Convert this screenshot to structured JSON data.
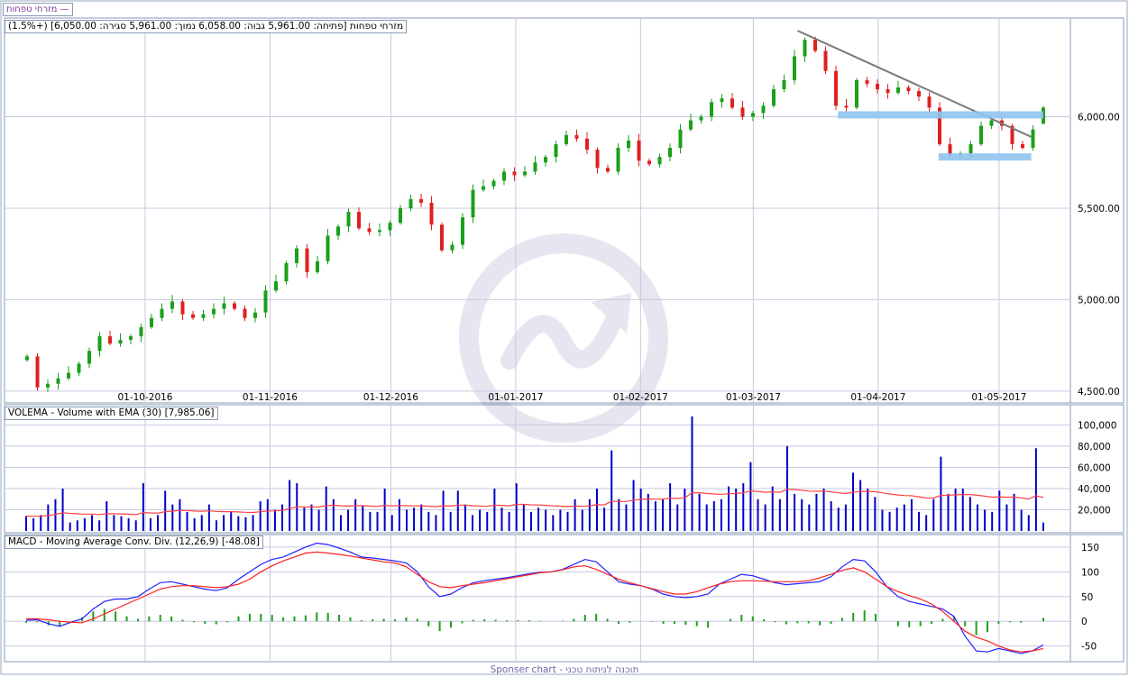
{
  "chart_title": "מזרחי טפחות —",
  "price_header": "מזרחי טפחות [פתיחה: 5,961.00  גבוה: 6,058.00  נמוך: 5,961.00  סגירה: 6,050.00] (+1.5%)",
  "volume_header": "VOLEMA - Volume with EMA (30) [7,985.06]",
  "macd_header": "MACD - Moving Average Conv. Div. (12,26,9) [-48.08]",
  "footer": "Sponser chart - תוכנה לניתוח טכני",
  "colors": {
    "up": "#1aa01a",
    "down": "#e02020",
    "volume": "#0000c8",
    "ema": "#ff4040",
    "macd": "#2020ff",
    "signal": "#ff2020",
    "hist": "#1aa01a",
    "trendline": "#7a7a7a",
    "support": "#8fc4f0",
    "grid": "#c8c8e0"
  },
  "chart_data": [
    {
      "type": "candlestick",
      "x_tick_labels": [
        "01-10-2016",
        "01-11-2016",
        "01-12-2016",
        "01-01-2017",
        "01-02-2017",
        "01-03-2017",
        "01-04-2017",
        "01-05-2017"
      ],
      "y_tick_labels": [
        "4,500.00",
        "5,000.00",
        "5,500.00",
        "6,000.00"
      ],
      "ylim": [
        4470,
        6500
      ],
      "last_candle": {
        "open": 5961,
        "high": 6058,
        "low": 5961,
        "close": 6050,
        "change_pct": 1.5
      },
      "close_series": [
        4690,
        4520,
        4540,
        4570,
        4600,
        4650,
        4720,
        4800,
        4760,
        4780,
        4800,
        4850,
        4900,
        4950,
        4990,
        4920,
        4900,
        4920,
        4950,
        4980,
        4950,
        4900,
        4930,
        5050,
        5100,
        5200,
        5280,
        5150,
        5210,
        5350,
        5400,
        5480,
        5390,
        5370,
        5380,
        5420,
        5500,
        5550,
        5530,
        5410,
        5270,
        5300,
        5450,
        5600,
        5620,
        5650,
        5700,
        5680,
        5700,
        5750,
        5780,
        5850,
        5900,
        5880,
        5820,
        5720,
        5700,
        5830,
        5870,
        5760,
        5740,
        5780,
        5830,
        5930,
        5980,
        6000,
        6080,
        6100,
        6050,
        6000,
        6020,
        6060,
        6150,
        6200,
        6330,
        6420,
        6360,
        6250,
        6060,
        6050,
        6200,
        6180,
        6150,
        6130,
        6160,
        6140,
        6110,
        6050,
        5850,
        5790,
        5800,
        5850,
        5950,
        5980,
        5950,
        5850,
        5830,
        5930,
        6050
      ],
      "trendline": {
        "from_date": "2017-03-12",
        "from_price": 6470,
        "to_date": "2017-05-09",
        "to_price": 5890
      },
      "support_bands": [
        {
          "price": 6010,
          "from_date": "2017-03-22",
          "to_date": "2017-05-12"
        },
        {
          "price": 5780,
          "from_date": "2017-04-16",
          "to_date": "2017-05-09"
        }
      ]
    },
    {
      "type": "bar",
      "y_tick_labels": [
        "20,000",
        "40,000",
        "60,000",
        "80,000",
        "100,000"
      ],
      "ylim": [
        0,
        108000
      ],
      "ema_period": 30,
      "ema_last": 7985.06,
      "volume_series": [
        14000,
        12000,
        15000,
        25000,
        30000,
        40000,
        8000,
        10000,
        12000,
        15000,
        10000,
        28000,
        15000,
        14000,
        12000,
        10000,
        45000,
        12000,
        15000,
        38000,
        25000,
        30000,
        18000,
        12000,
        15000,
        25000,
        10000,
        15000,
        18000,
        14000,
        13000,
        15000,
        28000,
        30000,
        20000,
        25000,
        48000,
        45000,
        22000,
        25000,
        20000,
        42000,
        30000,
        15000,
        20000,
        30000,
        24000,
        18000,
        18000,
        40000,
        15000,
        30000,
        20000,
        22000,
        25000,
        18000,
        15000,
        38000,
        18000,
        38000,
        25000,
        15000,
        20000,
        18000,
        40000,
        22000,
        18000,
        45000,
        25000,
        18000,
        22000,
        20000,
        15000,
        20000,
        18000,
        30000,
        20000,
        30000,
        40000,
        22000,
        76000,
        30000,
        25000,
        48000,
        40000,
        35000,
        28000,
        30000,
        45000,
        25000,
        40000,
        108000,
        35000,
        25000,
        28000,
        30000,
        42000,
        40000,
        45000,
        65000,
        30000,
        25000,
        42000,
        30000,
        80000,
        35000,
        30000,
        25000,
        35000,
        40000,
        28000,
        22000,
        25000,
        55000,
        48000,
        40000,
        32000,
        20000,
        18000,
        22000,
        25000,
        30000,
        18000,
        15000,
        30000,
        70000,
        35000,
        40000,
        40000,
        32000,
        25000,
        20000,
        18000,
        38000,
        25000,
        35000,
        20000,
        15000,
        78000,
        8000
      ]
    },
    {
      "type": "line",
      "y_tick_labels": [
        "-50",
        "0",
        "50",
        "100",
        "150"
      ],
      "ylim": [
        -78,
        168
      ],
      "params": "12,26,9",
      "last_value": -48.08,
      "series": [
        {
          "name": "MACD",
          "values": [
            2,
            3,
            -5,
            -10,
            -2,
            5,
            25,
            40,
            45,
            45,
            50,
            65,
            78,
            80,
            75,
            70,
            65,
            62,
            68,
            85,
            100,
            115,
            125,
            130,
            140,
            150,
            158,
            155,
            148,
            140,
            130,
            128,
            125,
            122,
            118,
            100,
            70,
            50,
            55,
            68,
            78,
            82,
            85,
            88,
            92,
            96,
            99,
            100,
            105,
            115,
            125,
            120,
            100,
            80,
            75,
            72,
            65,
            55,
            50,
            48,
            50,
            55,
            75,
            85,
            95,
            92,
            85,
            78,
            74,
            76,
            78,
            80,
            90,
            110,
            125,
            122,
            100,
            70,
            50,
            40,
            35,
            30,
            25,
            10,
            -30,
            -60,
            -62,
            -55,
            -60,
            -65,
            -60,
            -48
          ]
        },
        {
          "name": "Signal",
          "values": [
            5,
            5,
            3,
            0,
            -2,
            -3,
            5,
            15,
            25,
            35,
            45,
            55,
            65,
            70,
            72,
            72,
            70,
            68,
            70,
            75,
            85,
            100,
            112,
            122,
            130,
            138,
            140,
            138,
            135,
            132,
            128,
            124,
            120,
            118,
            110,
            95,
            80,
            70,
            68,
            72,
            75,
            78,
            82,
            86,
            90,
            94,
            98,
            100,
            104,
            110,
            112,
            105,
            95,
            85,
            78,
            72,
            66,
            60,
            55,
            55,
            60,
            68,
            75,
            80,
            82,
            82,
            81,
            80,
            80,
            80,
            82,
            88,
            95,
            103,
            108,
            100,
            85,
            70,
            60,
            52,
            45,
            35,
            20,
            0,
            -20,
            -32,
            -40,
            -50,
            -58,
            -62,
            -60,
            -55
          ]
        }
      ],
      "histogram": [
        -3,
        -2,
        -8,
        -10,
        0,
        8,
        20,
        25,
        20,
        10,
        5,
        10,
        13,
        10,
        3,
        -2,
        -5,
        -6,
        -2,
        10,
        15,
        15,
        13,
        8,
        10,
        12,
        18,
        17,
        13,
        8,
        2,
        4,
        5,
        4,
        8,
        5,
        -10,
        -20,
        -13,
        -4,
        3,
        4,
        3,
        2,
        2,
        2,
        1,
        0,
        1,
        5,
        13,
        15,
        5,
        -5,
        -3,
        0,
        -1,
        -5,
        -5,
        -7,
        -10,
        -13,
        0,
        5,
        13,
        10,
        4,
        -2,
        -6,
        -4,
        -4,
        -8,
        -5,
        7,
        17,
        22,
        15,
        0,
        -10,
        -12,
        -10,
        -5,
        5,
        10,
        -10,
        -28,
        -22,
        -5,
        -2,
        -3,
        0,
        7
      ]
    }
  ]
}
